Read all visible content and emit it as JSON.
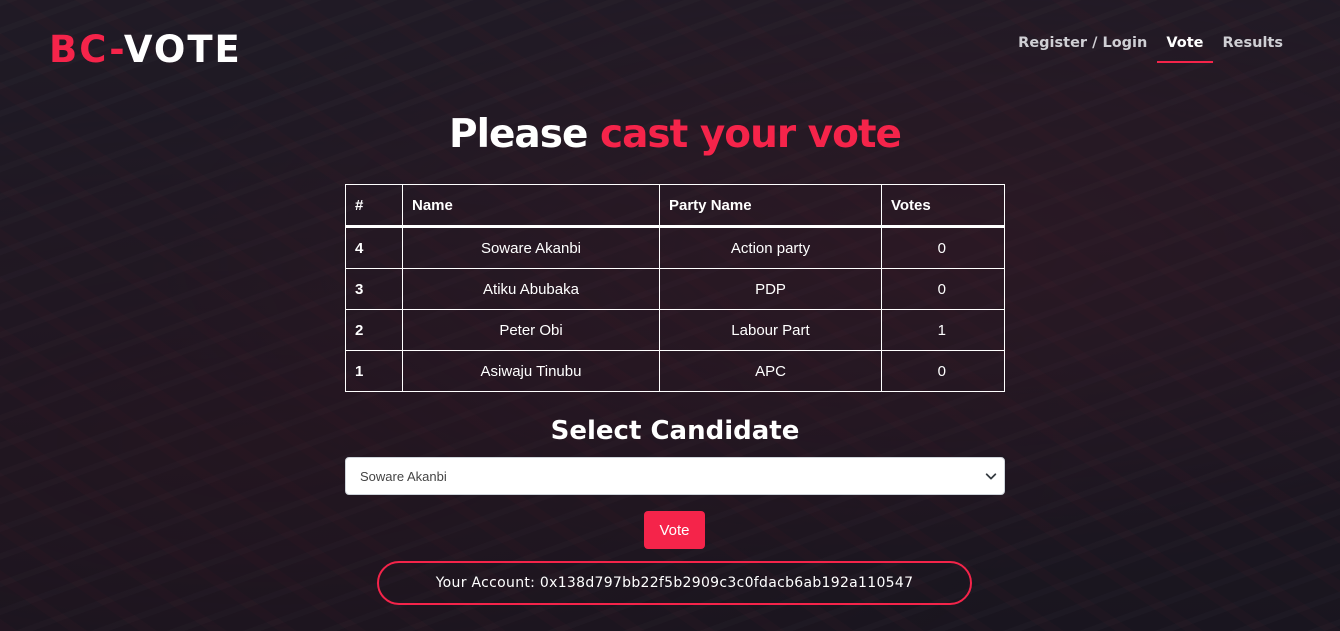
{
  "brand": {
    "prefix": "BC-",
    "suffix": "VOTE"
  },
  "nav": {
    "items": [
      {
        "label": "Register / Login",
        "active": false
      },
      {
        "label": "Vote",
        "active": true
      },
      {
        "label": "Results",
        "active": false
      }
    ]
  },
  "heading": {
    "lead": "Please ",
    "highlight": "cast your vote"
  },
  "table": {
    "headers": [
      "#",
      "Name",
      "Party Name",
      "Votes"
    ],
    "rows": [
      {
        "id": "4",
        "name": "Soware Akanbi",
        "party": "Action party",
        "votes": "0"
      },
      {
        "id": "3",
        "name": "Atiku Abubaka",
        "party": "PDP",
        "votes": "0"
      },
      {
        "id": "2",
        "name": "Peter Obi",
        "party": "Labour Part",
        "votes": "1"
      },
      {
        "id": "1",
        "name": "Asiwaju Tinubu",
        "party": "APC",
        "votes": "0"
      }
    ]
  },
  "select": {
    "heading": "Select Candidate",
    "selected": "Soware Akanbi"
  },
  "vote_button": {
    "label": "Vote"
  },
  "account": {
    "text": "Your Account: 0x138d797bb22f5b2909c3c0fdacb6ab192a110547"
  },
  "colors": {
    "accent": "#f5244a",
    "text": "#ffffff"
  },
  "icons": {
    "select_chevron": "chevron-down-icon"
  }
}
